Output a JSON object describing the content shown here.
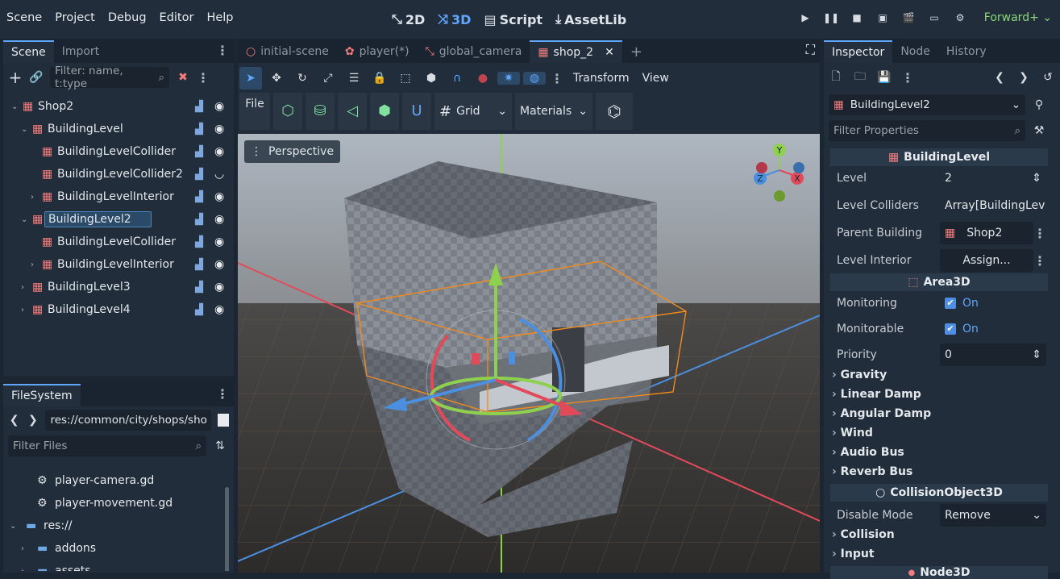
{
  "menu": [
    "Scene",
    "Project",
    "Debug",
    "Editor",
    "Help"
  ],
  "modes": [
    {
      "icon": "2d-icon",
      "glyph": "⤡",
      "label": "2D",
      "active": false
    },
    {
      "icon": "3d-icon",
      "glyph": "⤨",
      "label": "3D",
      "active": true
    },
    {
      "icon": "script-icon",
      "glyph": "▤",
      "label": "Script",
      "active": false
    },
    {
      "icon": "assetlib-icon",
      "glyph": "⤓",
      "label": "AssetLib",
      "active": false
    }
  ],
  "renderer": "Forward+ ⌄",
  "scene_dock": {
    "tabs": [
      "Scene",
      "Import"
    ],
    "filter_placeholder": "Filter: name, t:type",
    "tree": [
      {
        "label": "Shop2",
        "depth": 0,
        "arrow": "⌄",
        "icon_color": "#f27c7c"
      },
      {
        "label": "BuildingLevel",
        "depth": 1,
        "arrow": "⌄",
        "icon_color": "#f27c7c"
      },
      {
        "label": "BuildingLevelCollider",
        "depth": 2,
        "arrow": "",
        "icon_color": "#f27c7c"
      },
      {
        "label": "BuildingLevelCollider2",
        "depth": 2,
        "arrow": "",
        "icon_color": "#f27c7c",
        "eye_closed": true
      },
      {
        "label": "BuildingLevelInterior",
        "depth": 2,
        "arrow": "›",
        "icon_color": "#f27c7c"
      },
      {
        "label": "BuildingLevel2",
        "depth": 1,
        "arrow": "⌄",
        "icon_color": "#f27c7c",
        "selected": true
      },
      {
        "label": "BuildingLevelCollider",
        "depth": 2,
        "arrow": "",
        "icon_color": "#f27c7c"
      },
      {
        "label": "BuildingLevelInterior",
        "depth": 2,
        "arrow": "›",
        "icon_color": "#f27c7c"
      },
      {
        "label": "BuildingLevel3",
        "depth": 1,
        "arrow": "›",
        "icon_color": "#f27c7c"
      },
      {
        "label": "BuildingLevel4",
        "depth": 1,
        "arrow": "›",
        "icon_color": "#f27c7c"
      }
    ]
  },
  "filesystem": {
    "tab": "FileSystem",
    "path": "res://common/city/shops/sho",
    "filter_placeholder": "Filter Files",
    "items": [
      {
        "label": "player-camera.gd",
        "icon": "gear-icon",
        "depth": 1,
        "arrow": ""
      },
      {
        "label": "player-movement.gd",
        "icon": "gear-icon",
        "depth": 1,
        "arrow": ""
      },
      {
        "label": "res://",
        "icon": "folder-icon",
        "depth": 0,
        "arrow": "⌄"
      },
      {
        "label": "addons",
        "icon": "folder-icon",
        "depth": 1,
        "arrow": "›"
      },
      {
        "label": "assets",
        "icon": "folder-icon",
        "depth": 1,
        "arrow": "›"
      }
    ]
  },
  "editor_tabs": [
    {
      "label": "initial-scene",
      "icon": "○"
    },
    {
      "label": "player(*)",
      "icon": "✿"
    },
    {
      "label": "global_camera",
      "icon": "⤡"
    },
    {
      "label": "shop_2",
      "icon": "▦",
      "active": true
    }
  ],
  "viewport_toolbar": {
    "transform": "Transform",
    "view": "View",
    "file": "File",
    "grid": "Grid",
    "materials": "Materials",
    "perspective": "Perspective"
  },
  "gizmo_axes": {
    "y": "Y",
    "z": "Z",
    "x": "X"
  },
  "inspector": {
    "tabs": [
      "Inspector",
      "Node",
      "History"
    ],
    "node": "BuildingLevel2",
    "filter_placeholder": "Filter Properties",
    "sections": {
      "building_level": "BuildingLevel",
      "area3d": "Area3D",
      "collision": "CollisionObject3D",
      "node3d": "Node3D"
    },
    "props": {
      "level": {
        "k": "Level",
        "v": "2"
      },
      "colliders": {
        "k": "Level Colliders",
        "v": "Array[BuildingLev"
      },
      "parent": {
        "k": "Parent Building",
        "v": "Shop2"
      },
      "interior": {
        "k": "Level Interior",
        "v": "Assign..."
      },
      "monitoring": {
        "k": "Monitoring",
        "v": "On"
      },
      "monitorable": {
        "k": "Monitorable",
        "v": "On"
      },
      "priority": {
        "k": "Priority",
        "v": "0"
      },
      "disable_mode": {
        "k": "Disable Mode",
        "v": "Remove"
      }
    },
    "groups": [
      "Gravity",
      "Linear Damp",
      "Angular Damp",
      "Wind",
      "Audio Bus",
      "Reverb Bus"
    ],
    "groups2": [
      "Collision",
      "Input"
    ]
  },
  "colors": {
    "accent": "#5fa7ff",
    "node_red": "#f27c7c",
    "renderer_green": "#8bd87a"
  }
}
